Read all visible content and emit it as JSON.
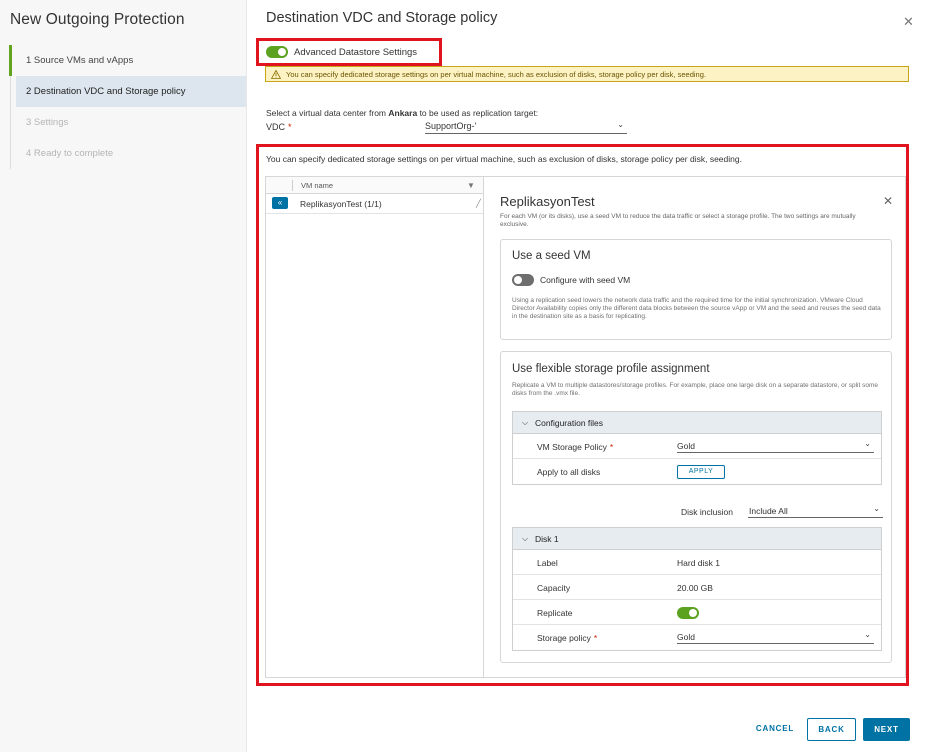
{
  "wizard": {
    "title": "New Outgoing Protection",
    "steps": [
      {
        "label": "1  Source VMs and vApps",
        "state": "done"
      },
      {
        "label": "2  Destination VDC and Storage policy",
        "state": "active"
      },
      {
        "label": "3  Settings",
        "state": "disabled"
      },
      {
        "label": "4  Ready to complete",
        "state": "disabled"
      }
    ]
  },
  "main": {
    "title": "Destination VDC and Storage policy",
    "advanced_toggle_label": "Advanced Datastore Settings",
    "warning_text": "You can specify dedicated storage settings on per virtual machine, such as exclusion of disks, storage policy per disk, seeding.",
    "select_prefix": "Select a virtual data center from ",
    "select_site": "Ankara",
    "select_suffix": " to be used as replication target:",
    "vdc_label": "VDC",
    "vdc_required": "*",
    "vdc_value": "SupportOrg-'",
    "description": "You can specify dedicated storage settings on per virtual machine, such as exclusion of disks, storage policy per disk, seeding."
  },
  "grid": {
    "column_header": "VM name",
    "rows": [
      {
        "name": "ReplikasyonTest (1/1)"
      }
    ]
  },
  "detail": {
    "title": "ReplikasyonTest",
    "subtitle": "For each VM (or its disks), use a seed VM to reduce the data traffic or select a storage profile. The two settings are mutually exclusive.",
    "seed": {
      "title": "Use a seed VM",
      "toggle_label": "Configure with seed VM",
      "text": "Using a replication seed lowers the network data traffic and the required time for the initial synchronization. VMware Cloud Director Availability copies only the different data blocks between the source vApp or VM and the seed and reuses the seed data in the destination site as a basis for replicating."
    },
    "flex": {
      "title": "Use flexible storage profile assignment",
      "text": "Replicate a VM to multiple datastores/storage profiles. For example, place one large disk on a separate datastore, or split some disks from the .vmx file.",
      "config_files": {
        "header": "Configuration files",
        "storage_policy_label": "VM Storage Policy",
        "storage_policy_required": "*",
        "storage_policy_value": "Gold",
        "apply_label": "Apply to all disks",
        "apply_button": "APPLY"
      },
      "disk_inclusion_label": "Disk inclusion",
      "disk_inclusion_value": "Include All",
      "disk1": {
        "header": "Disk 1",
        "label_label": "Label",
        "label_value": "Hard disk 1",
        "capacity_label": "Capacity",
        "capacity_value": "20.00 GB",
        "replicate_label": "Replicate",
        "storage_policy_label": "Storage policy",
        "storage_policy_required": "*",
        "storage_policy_value": "Gold"
      }
    }
  },
  "footer": {
    "cancel": "CANCEL",
    "back": "BACK",
    "next": "NEXT"
  },
  "colors": {
    "accent": "#0072a3",
    "toggle_on": "#5aa220",
    "highlight": "#e0141e",
    "warning_bg": "#fdf2c4"
  }
}
